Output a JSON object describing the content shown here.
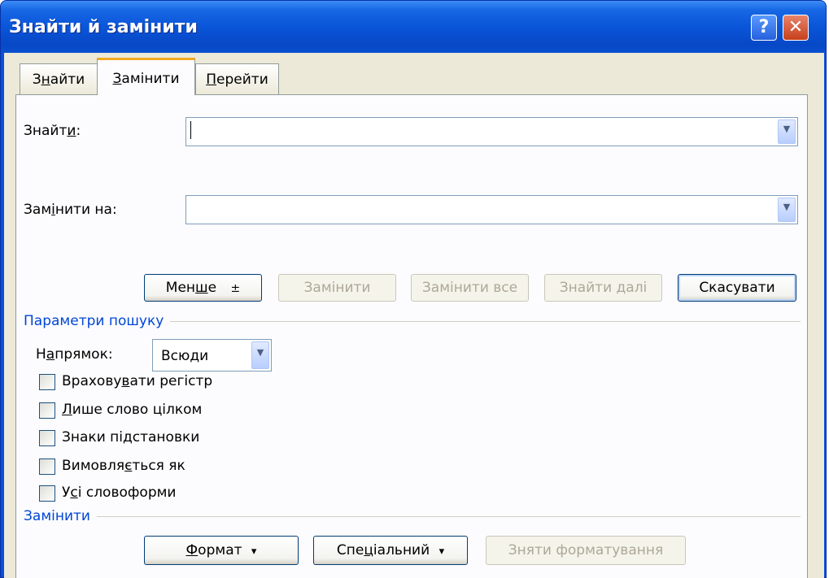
{
  "window": {
    "title": "Знайти й замінити"
  },
  "titlebar_buttons": {
    "help": "?",
    "close": "✕"
  },
  "tabs": [
    {
      "pre": "З",
      "ul": "н",
      "post": "айти"
    },
    {
      "pre": "",
      "ul": "З",
      "post": "амінити"
    },
    {
      "pre": "",
      "ul": "П",
      "post": "ерейти"
    }
  ],
  "find": {
    "pre": "Знайт",
    "ul": "и",
    "post": ":",
    "value": ""
  },
  "replace": {
    "pre": "Зам",
    "ul": "і",
    "post": "нити на:",
    "value": ""
  },
  "buttons": {
    "less": {
      "pre": "Мен",
      "ul": "ш",
      "post": "е",
      "arrow": "±"
    },
    "replace": "Замінити",
    "replace_all": "Замінити все",
    "find_next": "Знайти далі",
    "cancel": "Скасувати"
  },
  "search_options": {
    "title": "Параметри пошуку",
    "direction": {
      "pre": "Н",
      "ul": "а",
      "post": "прямок:",
      "value": "Всюди"
    },
    "checkboxes": [
      {
        "pre": "Врахову",
        "ul": "в",
        "post": "ати регістр"
      },
      {
        "pre": "",
        "ul": "Л",
        "post": "ише слово цілком"
      },
      {
        "pre": "Знаки пі",
        "ul": "д",
        "post": "становки"
      },
      {
        "pre": "Вимовля",
        "ul": "є",
        "post": "ться як"
      },
      {
        "pre": "У",
        "ul": "с",
        "post": "і словоформи"
      }
    ]
  },
  "replace_section": {
    "title": "Замінити",
    "format": {
      "pre": "",
      "ul": "Ф",
      "post": "ормат",
      "arrow": "▾"
    },
    "special": {
      "pre": "Спе",
      "ul": "ц",
      "post": "іальний",
      "arrow": "▾"
    },
    "clear_formatting": "Зняти форматування"
  },
  "icons": {
    "dropdown": "chevron-down-icon"
  }
}
